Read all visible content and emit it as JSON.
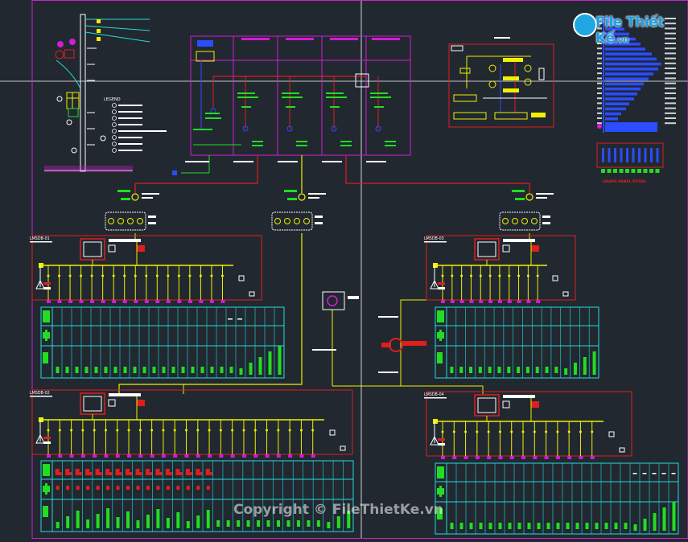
{
  "logo": {
    "brand": "File Thiết Kế",
    "tld": ".vn"
  },
  "watermark": "Copyright © FileThietKe.vn",
  "legend": {
    "title": "LEGEND"
  },
  "stats": {
    "title": "GRAPH PANEL DETAIL"
  },
  "panels": [
    {
      "id": "panel-1",
      "label": "LMSDB-01"
    },
    {
      "id": "panel-2",
      "label": "LMSDB-02"
    },
    {
      "id": "panel-3",
      "label": "LMSDB-03"
    },
    {
      "id": "panel-4",
      "label": "LMSDB-04"
    }
  ],
  "colors": {
    "background": "#212830",
    "red": "#e01e1e",
    "yellow": "#f0f000",
    "green": "#22dd22",
    "cyan": "#22dddd",
    "magenta": "#d21ed2",
    "blue": "#2a4dff",
    "white": "#ffffff"
  }
}
